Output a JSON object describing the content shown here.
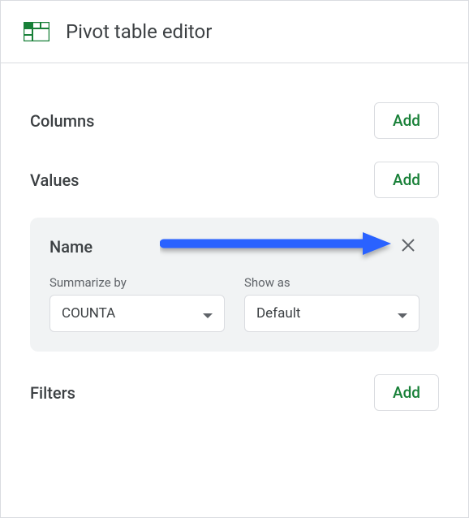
{
  "header": {
    "title": "Pivot table editor"
  },
  "sections": {
    "columns": {
      "title": "Columns",
      "add_label": "Add"
    },
    "values": {
      "title": "Values",
      "add_label": "Add",
      "card": {
        "field_name": "Name",
        "summarize_label": "Summarize by",
        "summarize_value": "COUNTA",
        "show_as_label": "Show as",
        "show_as_value": "Default"
      }
    },
    "filters": {
      "title": "Filters",
      "add_label": "Add"
    }
  }
}
